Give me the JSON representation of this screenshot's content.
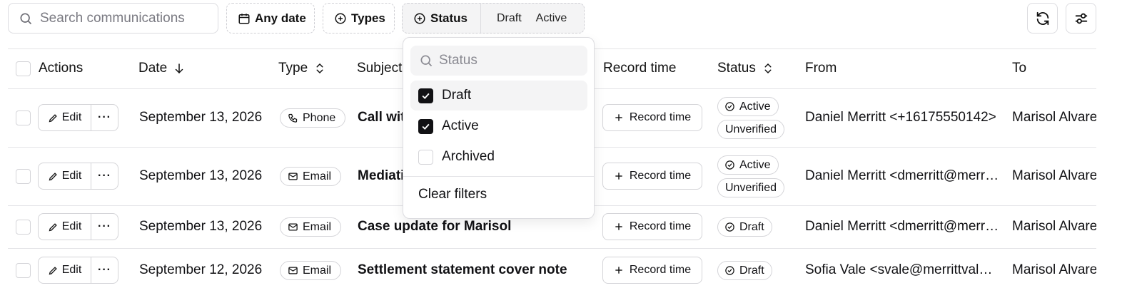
{
  "toolbar": {
    "search_placeholder": "Search communications",
    "date_filter": "Any date",
    "types_filter": "Types",
    "status_filter": "Status",
    "status_chips": [
      "Draft",
      "Active"
    ],
    "refresh_icon": "refresh-icon",
    "settings_icon": "sliders-icon"
  },
  "table": {
    "headers": {
      "actions": "Actions",
      "date": "Date",
      "type": "Type",
      "subject": "Subject",
      "record_time": "Record time",
      "status": "Status",
      "from": "From",
      "to": "To"
    },
    "rows": [
      {
        "edit": "Edit",
        "more": "···",
        "date": "September 13, 2026",
        "type": "Phone",
        "subject": "Call with Marisol",
        "record_time": "Record time",
        "status": "Active",
        "verification": "Unverified",
        "from": "Daniel Merritt <+16175550142>",
        "to": "Marisol Alvarez"
      },
      {
        "edit": "Edit",
        "more": "···",
        "date": "September 13, 2026",
        "type": "Email",
        "subject": "Mediation scheduling",
        "record_time": "Record time",
        "status": "Active",
        "verification": "Unverified",
        "from": "Daniel Merritt <dmerritt@merrittvale.com>",
        "to": "Marisol Alvarez"
      },
      {
        "edit": "Edit",
        "more": "···",
        "date": "September 13, 2026",
        "type": "Email",
        "subject": "Case update for Marisol",
        "record_time": "Record time",
        "status": "Draft",
        "from": "Daniel Merritt <dmerritt@merrittvale.com>",
        "to": "Marisol Alvarez"
      },
      {
        "edit": "Edit",
        "more": "···",
        "date": "September 12, 2026",
        "type": "Email",
        "subject": "Settlement statement cover note",
        "record_time": "Record time",
        "status": "Draft",
        "from": "Sofia Vale <svale@merrittvale.com>",
        "to": "Marisol Alvarez"
      }
    ]
  },
  "status_dropdown": {
    "search_placeholder": "Status",
    "options": [
      {
        "label": "Draft",
        "checked": true
      },
      {
        "label": "Active",
        "checked": true
      },
      {
        "label": "Archived",
        "checked": false
      }
    ],
    "clear_label": "Clear filters"
  }
}
